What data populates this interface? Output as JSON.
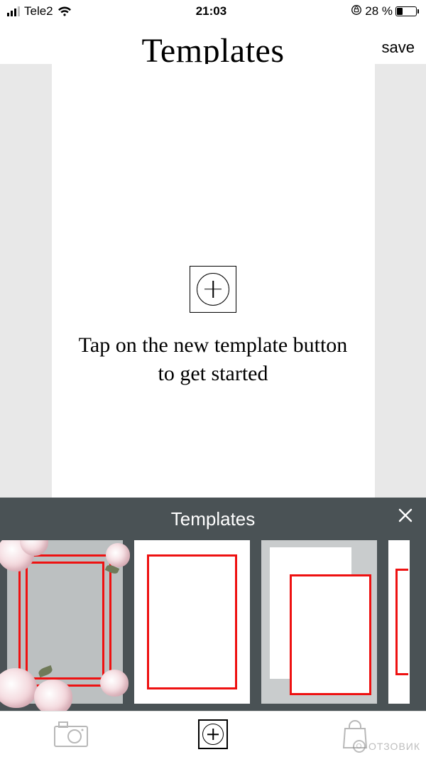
{
  "status": {
    "carrier": "Tele2",
    "time": "21:03",
    "battery_percent": "28 %"
  },
  "header": {
    "title": "Templates",
    "save_label": "save"
  },
  "canvas": {
    "hint": "Tap on the new template button to get started"
  },
  "drawer": {
    "title": "Templates"
  },
  "watermark": {
    "text": "ОТЗОВИК"
  }
}
